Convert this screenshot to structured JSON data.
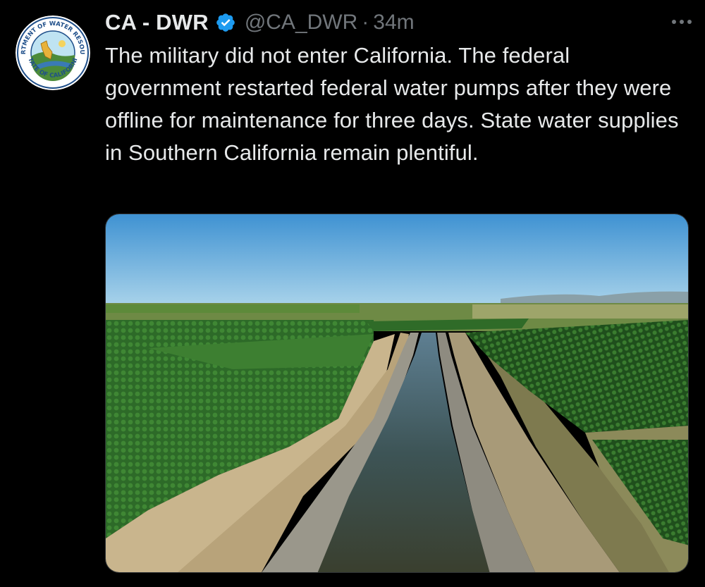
{
  "tweet": {
    "display_name": "CA - DWR",
    "handle": "@CA_DWR",
    "separator": "·",
    "time": "34m",
    "text": "The military did not enter California. The federal government restarted federal water pumps after they were offline for maintenance for three days. State water supplies in Southern California remain plentiful.",
    "verified_color": "#1d9bf0",
    "more_icon": "ellipsis-icon"
  },
  "avatar": {
    "seal_top_text": "DEPARTMENT OF WATER RESOURCES",
    "seal_bottom_text": "STATE OF CALIFORNIA"
  },
  "media": {
    "description_icon": "aerial-canal-photo"
  }
}
